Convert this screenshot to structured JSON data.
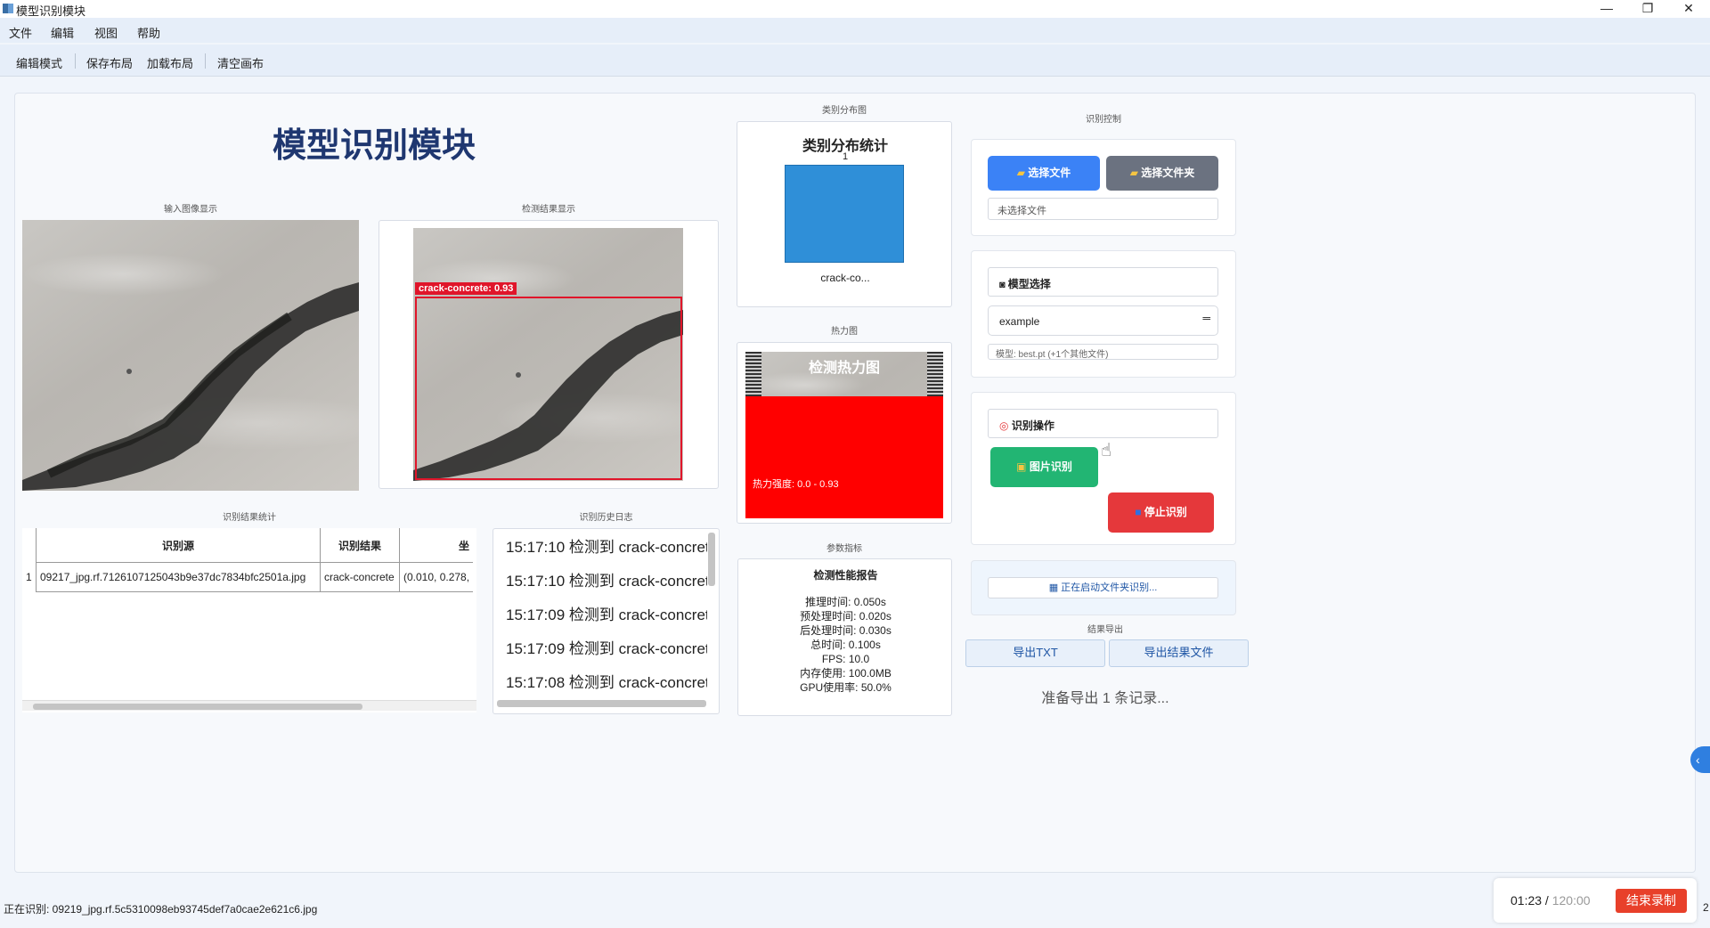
{
  "window": {
    "title": "模型识别模块",
    "min_icon": "—",
    "restore_icon": "❐",
    "close_icon": "✕"
  },
  "menu": [
    "文件",
    "编辑",
    "视图",
    "帮助"
  ],
  "toolbar": [
    "编辑模式",
    "保存布局",
    "加载布局",
    "清空画布"
  ],
  "main_title": "模型识别模块",
  "captions": {
    "input_image": "输入图像显示",
    "detect_result": "检测结果显示",
    "result_stats": "识别结果统计",
    "history_log": "识别历史日志",
    "class_dist": "类别分布图",
    "heatmap": "热力图",
    "metrics": "参数指标",
    "control": "识别控制",
    "export": "结果导出"
  },
  "detection": {
    "label": "crack-concrete: 0.93",
    "box_color": "#e0152a"
  },
  "results_table": {
    "headers": [
      "识别源",
      "识别结果",
      "坐"
    ],
    "rows": [
      {
        "index": "1",
        "source": "09217_jpg.rf.7126107125043b9e37dc7834bfc2501a.jpg",
        "result": "crack-concrete",
        "coords": "(0.010, 0.278,"
      }
    ]
  },
  "history": [
    "15:17:10 检测到 crack-concret",
    "15:17:10 检测到 crack-concret",
    "15:17:09 检测到 crack-concret",
    "15:17:09 检测到 crack-concret",
    "15:17:08 检测到 crack-concret"
  ],
  "class_chart": {
    "title": "类别分布统计",
    "bar_label": "1",
    "category_label": "crack-co...",
    "bar_color": "#2f8fd8"
  },
  "chart_data": {
    "type": "bar",
    "title": "类别分布统计",
    "categories": [
      "crack-co..."
    ],
    "values": [
      1
    ],
    "ylim": [
      0,
      1
    ]
  },
  "heatmap": {
    "title": "检测热力图",
    "range_text": "热力强度: 0.0 - 0.93",
    "color": "#ff0000"
  },
  "metrics": {
    "title": "检测性能报告",
    "lines": [
      "推理时间: 0.050s",
      "预处理时间: 0.020s",
      "后处理时间: 0.030s",
      "总时间: 0.100s",
      "FPS: 10.0",
      "内存使用: 100.0MB",
      "GPU使用率: 50.0%"
    ]
  },
  "control": {
    "select_file": "选择文件",
    "select_folder": "选择文件夹",
    "file_status": "未选择文件",
    "model_header": "模型选择",
    "model_value": "example",
    "model_info": "模型: best.pt (+1个其他文件)",
    "ops_header": "识别操作",
    "image_detect": "图片识别",
    "stop_detect": "停止识别",
    "folder_status": "正在启动文件夹识别..."
  },
  "export": {
    "txt": "导出TXT",
    "file": "导出结果文件",
    "status": "准备导出 1 条记录..."
  },
  "statusbar": {
    "text": "正在识别: 09219_jpg.rf.5c5310098eb93745def7a0cae2e621c6.jpg",
    "right_digit": "2"
  },
  "recorder": {
    "elapsed": "01:23",
    "separator": " / ",
    "total": "120:00",
    "end_label": "结束录制"
  },
  "colors": {
    "primary": "#3b82f6",
    "gray": "#6b7280",
    "green": "#22b573",
    "red": "#e5383b",
    "title_blue": "#1f3770"
  }
}
